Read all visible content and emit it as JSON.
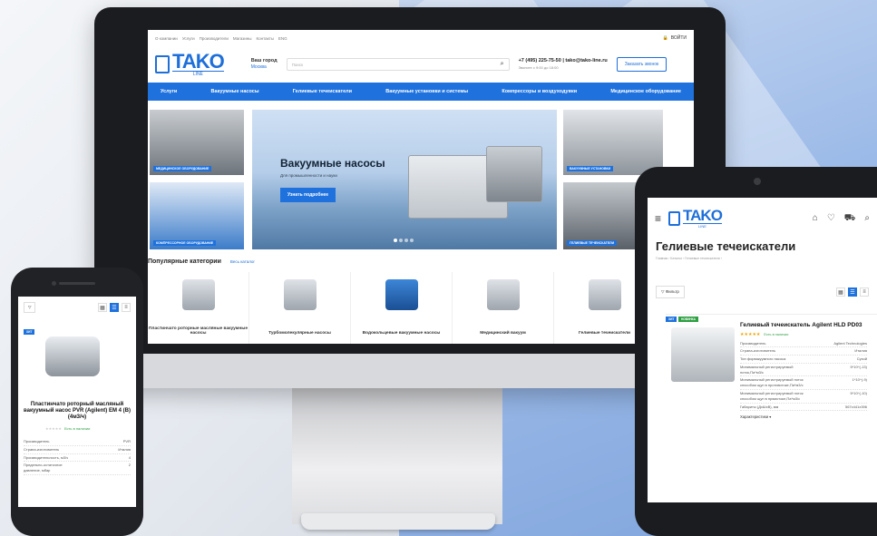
{
  "desktop": {
    "topbar": {
      "links": [
        "О компании",
        "Услуги",
        "Производители",
        "Магазины",
        "Контакты",
        "ENG"
      ],
      "login": "ВОЙТИ"
    },
    "header": {
      "logo_text": "TAKO",
      "logo_sub": "LINE",
      "city_label": "Ваш город",
      "city_value": "Москва",
      "search_placeholder": "Поиск",
      "phone": "+7 (495) 225-75-50 | tako@tako-line.ru",
      "hours": "Звоните с 9:00 до 18:00",
      "cta": "Заказать звонок"
    },
    "nav": [
      "Услуги",
      "Вакуумные насосы",
      "Гелиевые течеискатели",
      "Вакуумные установки и системы",
      "Компрессоры и воздуходувки",
      "Медицинское оборудование"
    ],
    "banners": {
      "left_top_tag": "МЕДИЦИНСКОЕ ОБОРУДОВАНИЕ",
      "left_bottom_tag": "КОМПРЕССОРНОЕ ОБОРУДОВАНИЕ",
      "right_top_tag": "ВАКУУМНЫЕ УСТАНОВКИ",
      "right_bottom_tag": "ГЕЛИЕВЫЕ ТЕЧЕИСКАТЕЛИ",
      "hero_title": "Вакуумные насосы",
      "hero_subtitle": "Для промышленности и науки",
      "hero_button": "Узнать подробнее"
    },
    "categories": {
      "title": "Популярные категории",
      "all_link": "Весь каталог",
      "items": [
        "Пластинчато роторные масляные вакуумные насосы",
        "Турбомолекулярные насосы",
        "Водокольцевые вакуумные насосы",
        "Медицинский вакуум",
        "Гелиевые течеискатели"
      ]
    }
  },
  "tablet": {
    "logo_text": "TAKO",
    "logo_sub": "LINE",
    "page_title": "Гелиевые течеискатели",
    "breadcrumb": "Главная › Каталог › Гелиевые течеискатели ›",
    "filter_label": "Фильтр",
    "product": {
      "badge_hit": "ХИТ",
      "badge_new": "НОВИНКА",
      "title": "Гелиевый течеискатель Agilent HLD PD03",
      "stars": "★★★★★",
      "availability": "Есть в наличии",
      "specs": [
        {
          "k": "Производитель",
          "v": "Agilent Technologies"
        },
        {
          "k": "Страна-изготовитель",
          "v": "Италия"
        },
        {
          "k": "Тип форвакуумного насоса",
          "v": "Сухой"
        },
        {
          "k": "Минимальный регистрируемый поток,Па*м3/с",
          "v": "5*10^(-13)"
        },
        {
          "k": "Минимальный регистрируемый поток способом щуп в противотоке,Па*м3/с",
          "v": "1*10^(-9)"
        },
        {
          "k": "Минимальный регистрируемый поток способом щуп в прямотоке,Па*м3/с",
          "v": "5*10^(-10)"
        },
        {
          "k": "Габариты (ДхШхВ), мм",
          "v": "567х441х396"
        }
      ],
      "more": "Характеристики ▾"
    }
  },
  "phone": {
    "badge_hit": "ХИТ",
    "product_title": "Пластинчато роторный масляный вакуумный насос PVR (Agilent) EM 4 (В) (4м3/ч)",
    "availability": "Есть в наличии",
    "specs": [
      {
        "k": "Производитель",
        "v": "PVR"
      },
      {
        "k": "Страна-изготовитель",
        "v": "Италия"
      },
      {
        "k": "Производительность, м3/ч",
        "v": "4"
      },
      {
        "k": "Предельно-остаточное давление, мбар",
        "v": "2"
      }
    ]
  },
  "colors": {
    "accent": "#1f72dd",
    "hit": "#1f72dd",
    "new": "#2ea043"
  }
}
